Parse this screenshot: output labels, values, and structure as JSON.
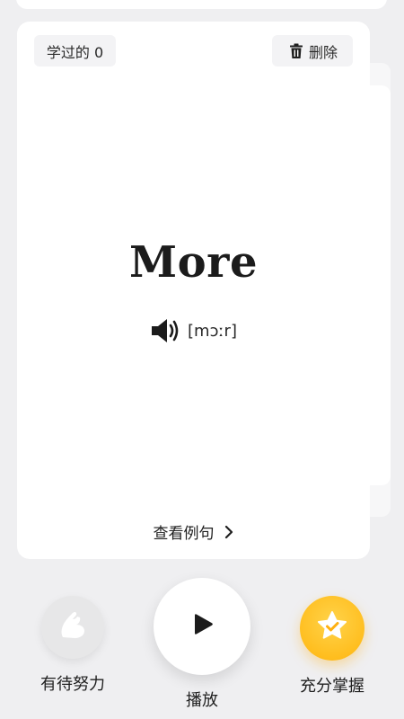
{
  "card": {
    "learned_label": "学过的 0",
    "delete_label": "删除",
    "word": "More",
    "phonetic": "[mɔːr]",
    "examples_label": "查看例句"
  },
  "controls": {
    "left_label": "有待努力",
    "center_label": "播放",
    "right_label": "充分掌握"
  },
  "icons": {
    "delete": "trash-icon",
    "pronounce": "speaker-icon",
    "examples": "chevron-right-icon",
    "left": "flexed-arm-icon",
    "center": "play-icon",
    "right": "star-check-icon"
  },
  "colors": {
    "background": "#efeff1",
    "card": "#ffffff",
    "accent_gold": "#ffbe1f"
  }
}
